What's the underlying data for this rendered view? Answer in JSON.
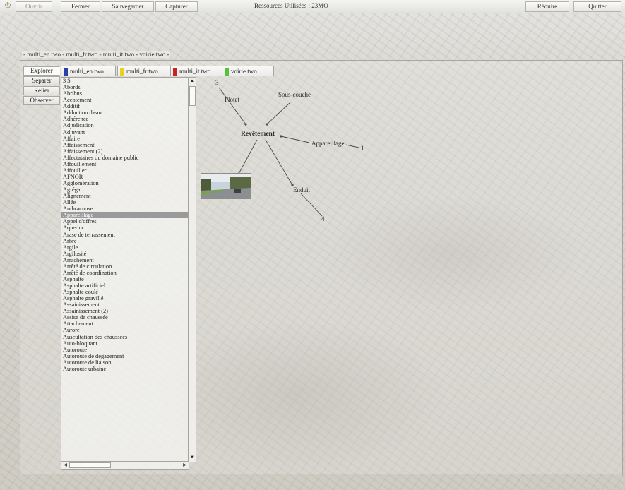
{
  "toolbar": {
    "ouvrir": "Ouvrir",
    "fermer": "Fermer",
    "sauvegarder": "Sauvegarder",
    "capturer": "Capturer",
    "status": "Ressources Utilisées : 23MO",
    "reduire": "Réduire",
    "quitter": "Quitter"
  },
  "window_title": "- multi_en.two - multi_fr.two - multi_it.two - voirie.two -",
  "side_tabs": [
    "Explorer",
    "Séparer",
    "Relier",
    "Observer"
  ],
  "doc_tabs": [
    {
      "label": "multi_en.two",
      "color": "#2c3fa8"
    },
    {
      "label": "multi_fr.two",
      "color": "#e6d21d"
    },
    {
      "label": "multi_it.two",
      "color": "#cc2121"
    },
    {
      "label": "voirie.two",
      "color": "#55c23c"
    }
  ],
  "list": {
    "items": [
      "3 $",
      "Abords",
      "Abribus",
      "Accotement",
      "Additif",
      "Adduction d'eau",
      "Adhérence",
      "Adjudication",
      "Adjuvant",
      "Affaire",
      "Affaissement",
      "Affaissement (2)",
      "Affectataires du domaine public",
      "Affouillement",
      "Affouiller",
      "AFNOR",
      "Agglomération",
      "Agrégat",
      "Alignement",
      "Allée",
      "Anthracnose",
      "Appareillage",
      "Appel d'offres",
      "Aqueduc",
      "Arase de terrassement",
      "Arbre",
      "Argile",
      "Argilosité",
      "Arrachement",
      "Arrêté de circulation",
      "Arrêté de coordination",
      "Asphalte",
      "Asphalte artificiel",
      "Asphalte coulé",
      "Asphalte gravillé",
      "Assainissement",
      "Assainissement (2)",
      "Assise de chaussée",
      "Attachement",
      "Aurore",
      "Auscultation des chaussées",
      "Auto-bloquant",
      "Autoroute",
      "Autoroute de dégagement",
      "Autoroute de liaison",
      "Autoroute urbaine"
    ],
    "selected": "Appareillage"
  },
  "graph": {
    "center": "Revêtement",
    "nodes": [
      "Plotet",
      "Sous-couche",
      "Appareillage",
      "Enduit"
    ],
    "counts": [
      "3",
      "1",
      "4"
    ]
  }
}
